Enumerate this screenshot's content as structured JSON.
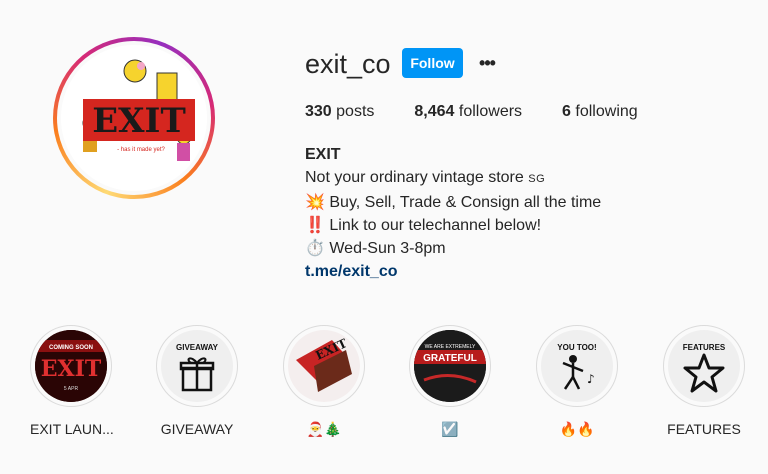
{
  "profile": {
    "username": "exit_co",
    "follow_label": "Follow",
    "more_label": "•••",
    "avatar_text": "EXIT",
    "avatar_subtext": "- has it made yet?"
  },
  "stats": {
    "posts_count": "330",
    "posts_label": "posts",
    "followers_count": "8,464",
    "followers_label": "followers",
    "following_count": "6",
    "following_label": "following"
  },
  "bio": {
    "name": "EXIT",
    "line1": "Not your ordinary vintage store",
    "line1_suffix": "SG",
    "line2": "💥 Buy, Sell, Trade & Consign all the time",
    "line3": "‼️ Link to our telechannel below!",
    "line4": "⏱️ Wed-Sun 3-8pm",
    "link": "t.me/exit_co"
  },
  "highlights": [
    {
      "label": "EXIT LAUN...",
      "cover_text": "EXIT",
      "cover_top": "COMING SOON",
      "cover_bottom": "5 APR"
    },
    {
      "label": "GIVEAWAY",
      "cover_title": "GIVEAWAY",
      "icon": "gift-icon"
    },
    {
      "label": "🎅🎄",
      "cover_text": "EXIT",
      "icon": "exit-art"
    },
    {
      "label": "☑️",
      "cover_top": "WE ARE EXTREMELY",
      "cover_text": "GRATEFUL"
    },
    {
      "label": "🔥🔥",
      "cover_title": "YOU TOO!",
      "icon": "dancer-icon"
    },
    {
      "label": "FEATURES",
      "cover_title": "FEATURES",
      "icon": "star-icon"
    }
  ],
  "colors": {
    "follow": "#0095f6",
    "link": "#00376b",
    "text": "#262626",
    "background": "#fafafa"
  }
}
